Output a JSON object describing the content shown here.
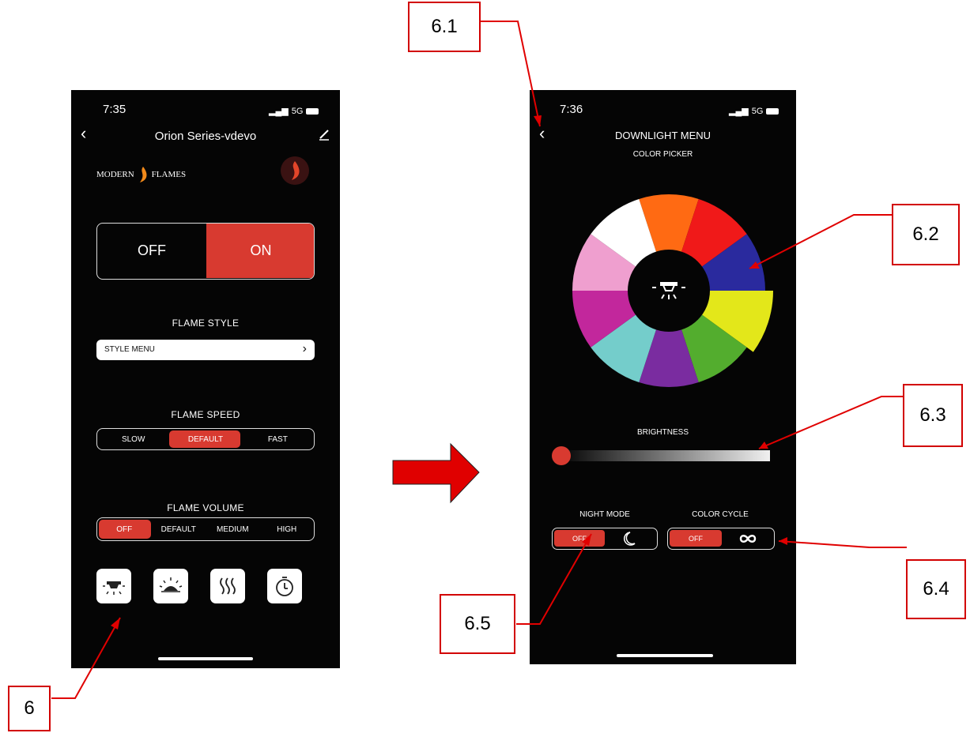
{
  "left_phone": {
    "status_time": "7:35",
    "status_network": "5G",
    "back_icon": "chevron-left-icon",
    "title": "Orion Series-vdevo",
    "edit_icon": "pencil-icon",
    "brand_left": "MODERN",
    "brand_right": "FLAMES",
    "power": {
      "off_label": "OFF",
      "on_label": "ON",
      "selected": "ON"
    },
    "flame_style": {
      "title": "FLAME STYLE",
      "menu_label": "STYLE MENU"
    },
    "flame_speed": {
      "title": "FLAME SPEED",
      "options": [
        "SLOW",
        "DEFAULT",
        "FAST"
      ],
      "selected": "DEFAULT"
    },
    "flame_volume": {
      "title": "FLAME VOLUME",
      "options": [
        "OFF",
        "DEFAULT",
        "MEDIUM",
        "HIGH"
      ],
      "selected": "OFF"
    },
    "bottom_icons": [
      "downlight-icon",
      "ember-light-icon",
      "heat-icon",
      "timer-icon"
    ]
  },
  "right_phone": {
    "status_time": "7:36",
    "status_network": "5G",
    "back_icon": "chevron-left-icon",
    "title": "DOWNLIGHT MENU",
    "subtitle": "COLOR PICKER",
    "color_wheel": [
      "#ff6a13",
      "#f01919",
      "#2a2a9e",
      "#e3e71a",
      "#53ad2e",
      "#7a2ca0",
      "#74cdcb",
      "#c2279c",
      "#ef9fcf",
      "#ffffff"
    ],
    "brightness_label": "BRIGHTNESS",
    "brightness_value": 0,
    "night_mode": {
      "title": "NIGHT MODE",
      "off_label": "OFF",
      "icon": "moon-icon"
    },
    "color_cycle": {
      "title": "COLOR CYCLE",
      "off_label": "OFF",
      "icon": "infinity-icon"
    }
  },
  "callouts": {
    "c6": "6",
    "c61": "6.1",
    "c62": "6.2",
    "c63": "6.3",
    "c64": "6.4",
    "c65": "6.5"
  },
  "colors": {
    "accent": "#d83a30",
    "callout": "#d20000",
    "arrow": "#e00000"
  }
}
